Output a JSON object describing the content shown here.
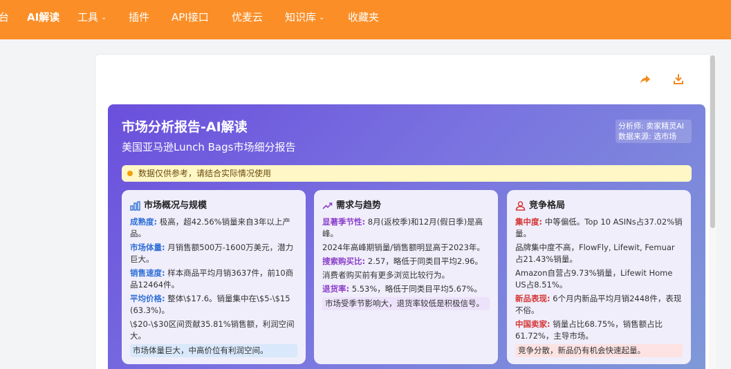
{
  "nav": {
    "items": [
      {
        "label": "台",
        "has_caret": false,
        "bold": false
      },
      {
        "label": "AI解读",
        "has_caret": false,
        "bold": true
      },
      {
        "label": "工具",
        "has_caret": true,
        "bold": false
      },
      {
        "label": "插件",
        "has_caret": false,
        "bold": false
      },
      {
        "label": "API接口",
        "has_caret": false,
        "bold": false
      },
      {
        "label": "优麦云",
        "has_caret": false,
        "bold": false
      },
      {
        "label": "知识库",
        "has_caret": true,
        "bold": false
      },
      {
        "label": "收藏夹",
        "has_caret": false,
        "bold": false
      }
    ],
    "caret": "⌄"
  },
  "toolbar": {
    "icons": [
      "share-icon",
      "download-icon"
    ],
    "accent": "#f28b1e"
  },
  "report": {
    "title": "市场分析报告-AI解读",
    "subtitle": "美国亚马逊Lunch Bags市场细分报告",
    "meta_analyst": "分析师: 卖家精灵AI",
    "meta_source": "数据来源: 选市场",
    "notice": "数据仅供参考，请结合实际情况使用"
  },
  "cards": {
    "market": {
      "title": "市场概况与规模",
      "icon": "bar-chart-icon",
      "rows": [
        {
          "key": "成熟度:",
          "text": " 极高，超42.56%销量来自3年以上产品。"
        },
        {
          "key": "市场体量:",
          "text": " 月销售额500万-1600万美元，潜力巨大。"
        },
        {
          "key": "销售速度:",
          "text": " 样本商品平均月销3637件，前10商品12464件。"
        },
        {
          "key": "平均价格:",
          "text": " 整体\\$17.6。销量集中在\\$5-\\$15 (63.3%)。"
        },
        {
          "key": "",
          "text": "\\$20-\\$30区间贡献35.81%销售额，利润空间大。"
        }
      ],
      "note": "市场体量巨大，中高价位有利润空间。"
    },
    "demand": {
      "title": "需求与趋势",
      "icon": "trend-up-icon",
      "rows": [
        {
          "key": "显著季节性:",
          "text": " 8月(返校季)和12月(假日季)是高峰。"
        },
        {
          "key": "",
          "text": "2024年高峰期销量/销售额明显高于2023年。"
        },
        {
          "key": "搜索购买比:",
          "text": " 2.57，略低于同类目平均2.96。"
        },
        {
          "key": "",
          "text": "消费者购买前有更多浏览比较行为。"
        },
        {
          "key": "退货率:",
          "text": " 5.53%，略低于同类目平均5.67%。"
        }
      ],
      "note": "市场受季节影响大，退货率较低是积极信号。"
    },
    "competition": {
      "title": "竞争格局",
      "icon": "users-icon",
      "rows": [
        {
          "key": "集中度:",
          "text": " 中等偏低。Top 10 ASINs占37.02%销量。"
        },
        {
          "key": "",
          "text": "品牌集中度不高，FlowFly, Lifewit, Femuar占21.43%销量。"
        },
        {
          "key": "",
          "text": "Amazon自营占9.73%销量，Lifewit Home US占8.51%。"
        },
        {
          "key": "新品表现:",
          "text": " 6个月内新品平均月销2448件，表现不俗。"
        },
        {
          "key": "中国卖家:",
          "text": " 销量占比68.75%，销售额占比61.72%，主导市场。"
        }
      ],
      "note": "竞争分散，新品仍有机会快速起量。"
    }
  }
}
